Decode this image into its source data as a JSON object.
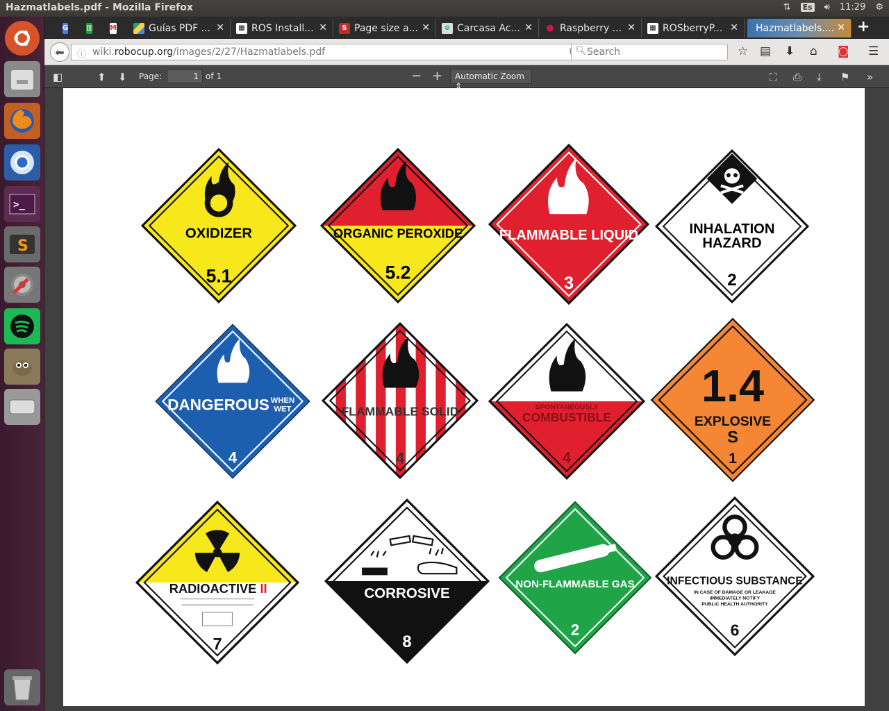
{
  "window_title": "Hazmatlabels.pdf - Mozilla Firefox",
  "tray": {
    "keyboard": "Es",
    "time": "11:29"
  },
  "tabs": [
    {
      "label": "Guías PDF ..."
    },
    {
      "label": "ROS Install..."
    },
    {
      "label": "Page size a..."
    },
    {
      "label": "Carcasa Ac..."
    },
    {
      "label": "Raspberry ..."
    },
    {
      "label": "ROSberryP..."
    },
    {
      "label": "Hazmatlabels...."
    }
  ],
  "url": {
    "prefix": "wiki.",
    "domain": "robocup.org",
    "path": "/images/2/27/Hazmatlabels.pdf"
  },
  "search_placeholder": "Search",
  "pdf": {
    "page_label": "Page:",
    "page": "1",
    "of": "of 1",
    "zoom": "Automatic Zoom"
  },
  "labels": {
    "oxidizer": {
      "text": "OXIDIZER",
      "num": "5.1"
    },
    "organic": {
      "text": "ORGANIC PEROXIDE",
      "num": "5.2"
    },
    "flam_liquid": {
      "text": "FLAMMABLE LIQUID",
      "num": "3"
    },
    "inhalation": {
      "line1": "INHALATION",
      "line2": "HAZARD",
      "num": "2"
    },
    "dangerous": {
      "text": "DANGEROUS",
      "when": "WHEN",
      "wet": "WET",
      "num": "4"
    },
    "flam_solid": {
      "text": "FLAMMABLE SOLID",
      "num": "4"
    },
    "spont": {
      "small": "SPONTANEOUSLY",
      "text": "COMBUSTIBLE",
      "num": "4"
    },
    "explosive": {
      "big": "1.4",
      "text": "EXPLOSIVE",
      "s": "S",
      "num": "1"
    },
    "radioactive": {
      "text": "RADIOACTIVE",
      "roman": "II",
      "num": "7"
    },
    "corrosive": {
      "text": "CORROSIVE",
      "num": "8"
    },
    "nonflam": {
      "text": "NON-FLAMMABLE GAS",
      "num": "2"
    },
    "infectious": {
      "text": "INFECTIOUS SUBSTANCE",
      "l1": "IN CASE OF DAMAGE OR LEAKAGE",
      "l2": "IMMEDIATELY NOTIFY",
      "l3": "PUBLIC HEALTH AUTHORITY",
      "num": "6"
    }
  },
  "colors": {
    "yellow": "#f7e81c",
    "red": "#e0202e",
    "blue": "#1c5fae",
    "orange": "#f58634",
    "green": "#1fa448"
  }
}
